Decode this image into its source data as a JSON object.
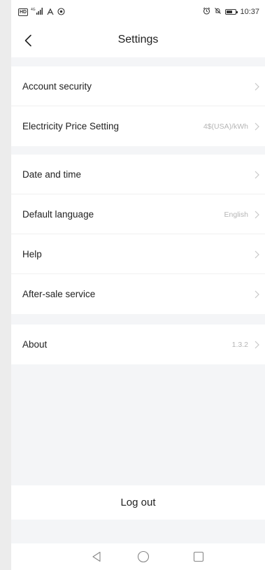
{
  "status_bar": {
    "left_badge": "HD",
    "signal_text": "4G",
    "time": "10:37",
    "battery_level": 0.7
  },
  "header": {
    "title": "Settings"
  },
  "groups": [
    {
      "items": [
        {
          "label": "Account security",
          "value": ""
        },
        {
          "label": "Electricity Price Setting",
          "value": "4$(USA)/kWh"
        }
      ]
    },
    {
      "items": [
        {
          "label": "Date and time",
          "value": ""
        },
        {
          "label": "Default language",
          "value": "English"
        },
        {
          "label": "Help",
          "value": ""
        },
        {
          "label": "After-sale service",
          "value": ""
        }
      ]
    },
    {
      "items": [
        {
          "label": "About",
          "value": "1.3.2"
        }
      ]
    }
  ],
  "logout_label": "Log out",
  "colors": {
    "background": "#f4f5f7",
    "card": "#ffffff",
    "chevron": "#c8c8c8",
    "value_text": "#b5b5b5"
  }
}
